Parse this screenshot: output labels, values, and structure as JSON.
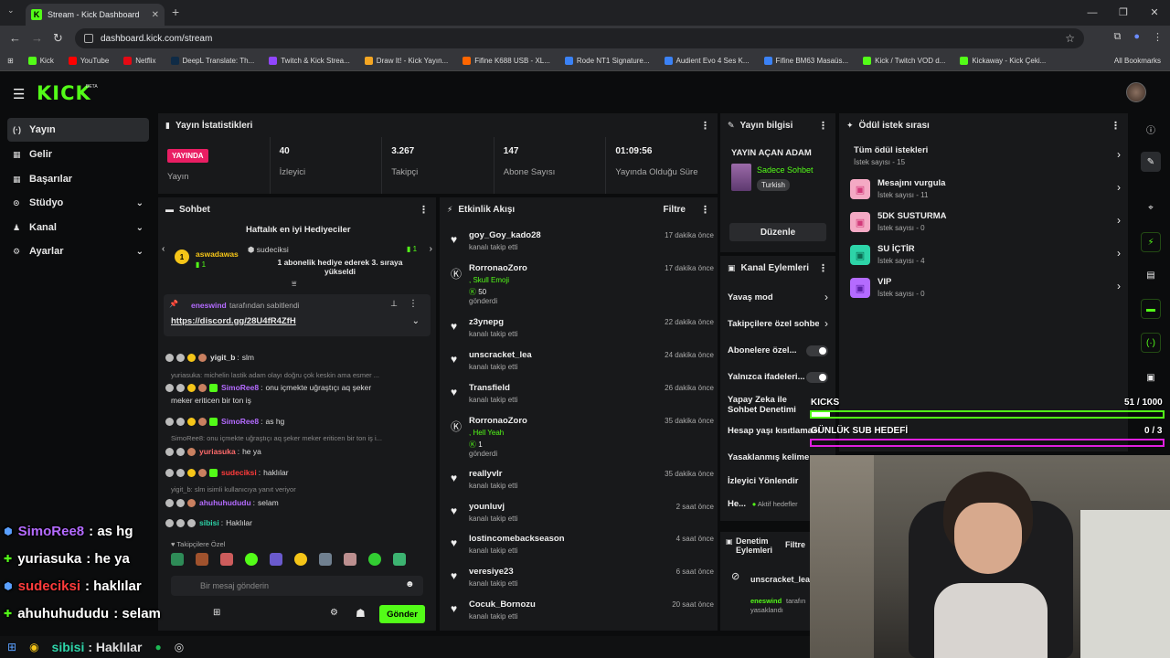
{
  "browser": {
    "tab_title": "Stream - Kick Dashboard",
    "url": "dashboard.kick.com/stream",
    "bookmarks": [
      {
        "label": "Kick",
        "color": "#53fc18"
      },
      {
        "label": "YouTube",
        "color": "#ff0000"
      },
      {
        "label": "Netflix",
        "color": "#e50914"
      },
      {
        "label": "DeepL Translate: Th...",
        "color": "#0f2b46"
      },
      {
        "label": "Twitch & Kick Strea...",
        "color": "#9146ff"
      },
      {
        "label": "Draw It! - Kick Yayın...",
        "color": "#f5a623"
      },
      {
        "label": "Fifine K688 USB - XL...",
        "color": "#ff6600"
      },
      {
        "label": "Rode NT1 Signature...",
        "color": "#3b82f6"
      },
      {
        "label": "Audient Evo 4 Ses K...",
        "color": "#3b82f6"
      },
      {
        "label": "Fifine BM63 Masaüs...",
        "color": "#3b82f6"
      },
      {
        "label": "Kick / Twitch VOD d...",
        "color": "#53fc18"
      },
      {
        "label": "Kickaway - Kick Çeki...",
        "color": "#53fc18"
      }
    ],
    "all_bookmarks": "All Bookmarks"
  },
  "header": {
    "logo": "KICK",
    "beta": "BETA"
  },
  "sidebar": {
    "items": [
      {
        "label": "Yayın",
        "icon": "(·)"
      },
      {
        "label": "Gelir",
        "icon": "▦"
      },
      {
        "label": "Başarılar",
        "icon": "▦"
      },
      {
        "label": "Stüdyo",
        "icon": "⊙"
      },
      {
        "label": "Kanal",
        "icon": "♟"
      },
      {
        "label": "Ayarlar",
        "icon": "⚙"
      }
    ]
  },
  "stats": {
    "title": "Yayın İstatistikleri",
    "live_badge": "YAYINDA",
    "live_label": "Yayın",
    "items": [
      {
        "value": "40",
        "label": "İzleyici"
      },
      {
        "value": "3.267",
        "label": "Takipçi"
      },
      {
        "value": "147",
        "label": "Abone Sayısı"
      },
      {
        "value": "01:09:56",
        "label": "Yayında Olduğu Süre"
      }
    ]
  },
  "stream_info": {
    "title": "Yayın bilgisi",
    "stream_title": "YAYIN AÇAN ADAM",
    "category": "Sadece Sohbet",
    "tag": "Turkish",
    "edit_button": "Düzenle"
  },
  "rewards": {
    "title": "Ödül istek sırası",
    "all_label": "Tüm ödül istekleri",
    "all_sub": "İstek sayısı - 15",
    "items": [
      {
        "name": "Mesajını vurgula",
        "sub": "İstek sayısı - 11",
        "color": "#f4a9c4",
        "icon_color": "#d23a7a"
      },
      {
        "name": "5DK SUSTURMA",
        "sub": "İstek sayısı - 0",
        "color": "#f4a9c4",
        "icon_color": "#d23a7a"
      },
      {
        "name": "SU İÇTİR",
        "sub": "İstek sayısı - 4",
        "color": "#2dd4a8",
        "icon_color": "#0b6b52"
      },
      {
        "name": "VIP",
        "sub": "İstek sayısı - 0",
        "color": "#b46bff",
        "icon_color": "#5b1fa8"
      }
    ]
  },
  "chat": {
    "title": "Sohbet",
    "gifters_title": "Haftalık en iyi Hediyeciler",
    "gifter1_name": "aswadawas",
    "gifter1_count": "1",
    "gifter2_name": "sudeciksi",
    "gifter2_count": "1",
    "gift_notice": "1 abonelik hediye ederek 3. sıraya yükseldi",
    "pinned_by_user": "eneswind",
    "pinned_by_text": "tarafından sabitlendi",
    "pinned_link": "https://discord.gg/28U4fR4ZfH",
    "messages": [
      {
        "user": "yigit_b",
        "text": "slm",
        "color": "#e8e8e8"
      },
      {
        "reply": "yuriasuka: michelin lastik adam olayı doğru çok keskin ama esmer ..."
      },
      {
        "user": "SimoRee8",
        "text": "onu içmekte uğraştıçı aq şeker",
        "text2": "meker eriticen bir ton iş",
        "color": "#b46bff"
      },
      {
        "user": "SimoRee8",
        "text": "as hg",
        "color": "#b46bff"
      },
      {
        "reply": "SimoRee8: onu içmekte uğraştıçı aq şeker meker eriticen bir ton iş i..."
      },
      {
        "user": "yuriasuka",
        "text": "he ya",
        "color": "#ff6b6b"
      },
      {
        "user": "sudeciksi",
        "text": "haklılar",
        "color": "#ff3b3b"
      },
      {
        "reply": "yigit_b: slm isimli kullanıcıya yanıt veriyor"
      },
      {
        "user": "ahuhuhududu",
        "text": "selam",
        "color": "#b46bff"
      },
      {
        "user": "sibisi",
        "text": "Haklılar",
        "color": "#2dd4a8"
      }
    ],
    "followers_only": "Takipçilere Özel",
    "input_placeholder": "Bir mesaj gönderin",
    "send_button": "Gönder"
  },
  "activity": {
    "title": "Etkinlik Akışı",
    "filter": "Filtre",
    "items": [
      {
        "name": "goy_Goy_kado28",
        "sub": "kanalı takip etti",
        "time": "17 dakika önce",
        "icon": "heart"
      },
      {
        "name": "RorronaoZoro",
        "sub": ", Skull Emoji",
        "amount": "50",
        "sub2": "gönderdi",
        "time": "17 dakika önce",
        "icon": "kick"
      },
      {
        "name": "z3ynepg",
        "sub": "kanalı takip etti",
        "time": "22 dakika önce",
        "icon": "heart"
      },
      {
        "name": "unscracket_lea",
        "sub": "kanalı takip etti",
        "time": "24 dakika önce",
        "icon": "heart"
      },
      {
        "name": "Transfield",
        "sub": "kanalı takip etti",
        "time": "26 dakika önce",
        "icon": "heart"
      },
      {
        "name": "RorronaoZoro",
        "sub": ", Hell Yeah",
        "amount": "1",
        "sub2": "gönderdi",
        "time": "35 dakika önce",
        "icon": "kick"
      },
      {
        "name": "reallyvlr",
        "sub": "kanalı takip etti",
        "time": "35 dakika önce",
        "icon": "heart"
      },
      {
        "name": "younluvj",
        "sub": "kanalı takip etti",
        "time": "2 saat önce",
        "icon": "heart"
      },
      {
        "name": "lostincomebackseason",
        "sub": "kanalı takip etti",
        "time": "4 saat önce",
        "icon": "heart"
      },
      {
        "name": "veresiye23",
        "sub": "kanalı takip etti",
        "time": "6 saat önce",
        "icon": "heart"
      },
      {
        "name": "Cocuk_Bornozu",
        "sub": "kanalı takip etti",
        "time": "20 saat önce",
        "icon": "heart"
      }
    ]
  },
  "channel_actions": {
    "title": "Kanal Eylemleri",
    "items": [
      {
        "label": "Yavaş mod",
        "kind": "chevron"
      },
      {
        "label": "Takipçilere özel sohbe",
        "kind": "chevron"
      },
      {
        "label": "Abonelere özel...",
        "kind": "toggle"
      },
      {
        "label": "Yalnızca ifadeleri...",
        "kind": "toggle"
      },
      {
        "label": "Yapay Zeka ile",
        "label2": "Sohbet Denetimi",
        "kind": "none"
      },
      {
        "label": "Hesap yaşı kısıtlaması",
        "kind": "none"
      },
      {
        "label": "Yasaklanmış kelime",
        "kind": "none"
      },
      {
        "label": "İzleyici Yönlendir",
        "kind": "none"
      },
      {
        "label": "He...",
        "extra": "Aktif hedefler",
        "kind": "none"
      }
    ]
  },
  "moderation": {
    "title": "Denetim Eylemleri",
    "filter": "Filtre",
    "item_name": "unscracket_lea",
    "item_user": "eneswind",
    "item_text": "tarafın",
    "item_text2": "yasaklandı"
  },
  "overlay": {
    "kicks_label": "KICKS",
    "kicks_value": "51 / 1000",
    "kicks_progress": 0.051,
    "sub_goal_label": "GÜNLÜK SUB HEDEFİ",
    "sub_goal_value": "0 / 3",
    "sub_goal_progress": 0.0,
    "chat": [
      {
        "user": "SimoRee8",
        "text": ": as hg",
        "color": "#b46bff"
      },
      {
        "user": "yuriasuka",
        "text": ": he ya",
        "color": "#ffffff"
      },
      {
        "user": "sudeciksi",
        "text": ": haklılar",
        "color": "#ff3b3b"
      },
      {
        "user": "ahuhuhududu",
        "text": ": selam",
        "color": "#ffffff"
      },
      {
        "user": "sibisi",
        "text": ": Haklılar",
        "color": "#2dd4a8"
      }
    ]
  }
}
